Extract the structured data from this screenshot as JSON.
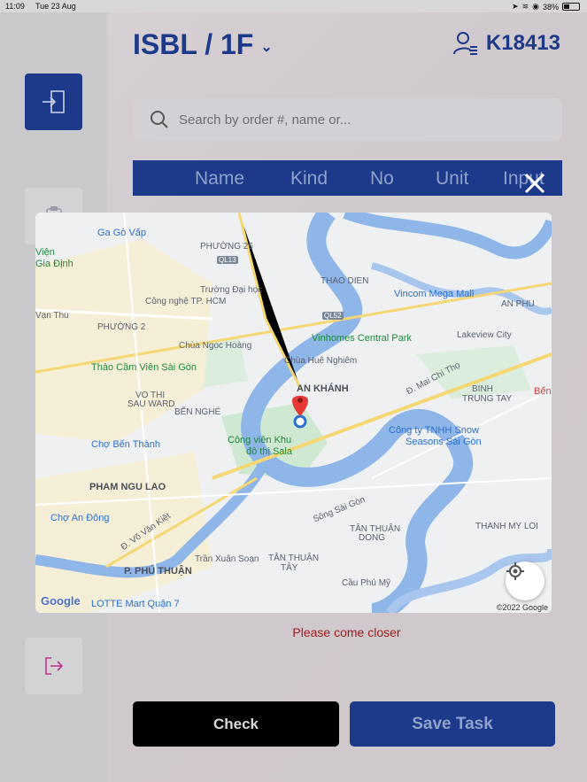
{
  "status_bar": {
    "time": "11:09",
    "date": "Tue 23 Aug",
    "battery": "38%"
  },
  "header": {
    "location": "ISBL / 1F",
    "user_id": "K18413"
  },
  "search": {
    "placeholder": "Search by order #, name or..."
  },
  "table": {
    "columns": [
      "Name",
      "Kind",
      "No",
      "Unit",
      "Input"
    ]
  },
  "map": {
    "labels": {
      "ga_go_vap": "Ga Gò Vấp",
      "phuong_26": "PHƯỜNG 26",
      "ql13": "QL13",
      "vien_gia_dinh_1": "Viện",
      "vien_gia_dinh_2": "Gia Định",
      "thao_dien": "THAO DIEN",
      "vincom": "Vincom Mega Mall",
      "an_phu": "AN PHU",
      "truong_dh_1": "Trường Đại học",
      "truong_dh_2": "Công nghệ TP. HCM",
      "ql52": "QL52",
      "phuong_2": "PHƯỜNG 2",
      "van_thu": "Vạn Thu",
      "vinhomes": "Vinhomes Central Park",
      "lakeview": "Lakeview City",
      "chua_ngoc_hoang": "Chùa Ngọc Hoàng",
      "chua_hue_nghiem": "Chùa Huê Nghiêm",
      "thao_cam_vien": "Thảo Cầm Viên Sài Gòn",
      "an_khanh": "AN KHÁNH",
      "mai_chi_tho": "Đ. Mai Chí Thọ",
      "binh_trung_tay_1": "BINH",
      "binh_trung_tay_2": "TRUNG TAY",
      "ben_1": "Bến",
      "vo_thi_sau_1": "VO THI",
      "vo_thi_sau_2": "SAU WARD",
      "ben_nghe": "BẾN NGHÉ",
      "cong_vien_khu_1": "Công viên Khu",
      "cong_vien_khu_2": "đô thị Sala",
      "cong_ty_1": "Công ty TNHH Snow",
      "cong_ty_2": "Seasons Sài Gòn",
      "cho_ben_thanh": "Chợ Bến Thành",
      "pham_ngu_lao": "PHAM NGU LAO",
      "song_sai_gon": "Sông Sài Gòn",
      "cho_an_dong": "Chợ An Đông",
      "vo_van_kiet": "Đ. Võ Văn Kiệt",
      "tan_thuan_dong_1": "TÂN THUẬN",
      "tan_thuan_dong_2": "DONG",
      "thanh_my_loi": "THANH MY LOI",
      "tran_xuan_soan": "Trần Xuân Soạn",
      "tan_thuan_tay_1": "TÂN THUẬN",
      "tan_thuan_tay_2": "TÂY",
      "phu_thuan": "P. PHÚ THUẬN",
      "cau_phu_my": "Cầu Phú Mỹ",
      "lotte": "LOTTE Mart Quận 7",
      "google": "Google",
      "copyright": "©2022 Google"
    }
  },
  "message": "Please come closer",
  "actions": {
    "check": "Check",
    "save": "Save Task"
  }
}
